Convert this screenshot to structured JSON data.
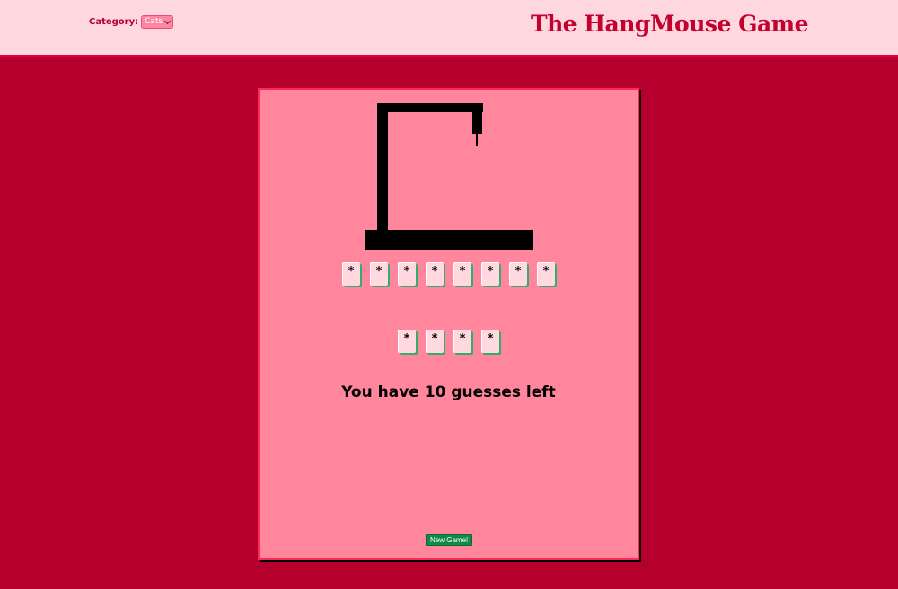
{
  "header": {
    "category_label": "Category:",
    "category_value": "Cats",
    "title": "The HangMouse Game"
  },
  "game": {
    "word_row_1": [
      "*",
      "*",
      "*",
      "*",
      "*",
      "*",
      "*",
      "*"
    ],
    "word_row_2": [
      "*",
      "*",
      "*",
      "*"
    ],
    "status": "You have 10 guesses left",
    "new_game_label": "New Game!"
  },
  "colors": {
    "background": "#b5002e",
    "header_bg": "#ffd7de",
    "title": "#c4002f",
    "card": "#ff869d",
    "button": "#128a47"
  }
}
